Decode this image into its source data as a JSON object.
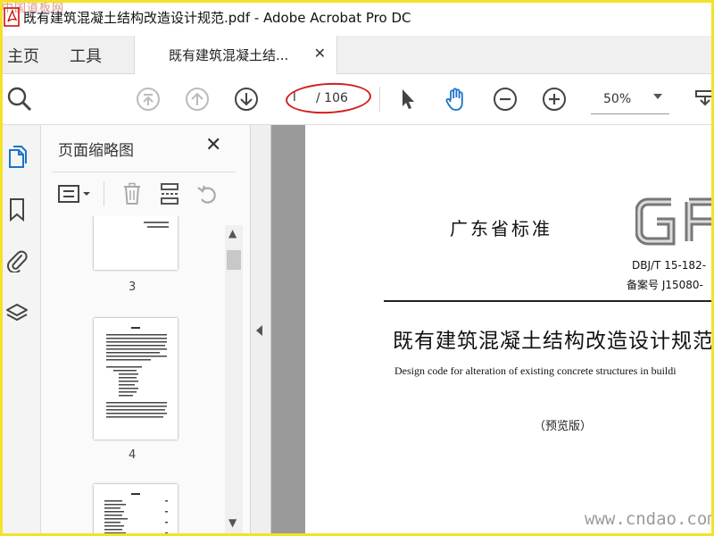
{
  "window": {
    "title": "既有建筑混凝土结构改造设计规范.pdf - Adobe Acrobat Pro DC",
    "watermark_top": "中国道板网"
  },
  "nav": {
    "home": "主页",
    "tools": "工具",
    "doc_tab": "既有建筑混凝土结...",
    "doc_tab_close": "✕"
  },
  "toolbar": {
    "page_current": "I",
    "page_total": "/ 106",
    "zoom": "50%"
  },
  "thumbnails": {
    "title": "页面缩略图",
    "close": "✕",
    "pages": [
      {
        "label": "3"
      },
      {
        "label": "4"
      },
      {
        "label": ""
      }
    ]
  },
  "document": {
    "heading": "广东省标准",
    "logo_text": "GI",
    "standard_code": "DBJ/T 15-182-",
    "record_number": "备案号 J15080-",
    "title": "既有建筑混凝土结构改造设计规范",
    "subtitle": "Design code for alteration of existing concrete structures in buildi",
    "edition": "（预览版）"
  },
  "watermark_bottom": "www.cndao.com",
  "colors": {
    "accent_blue": "#1a73c8",
    "annotation_red": "#d21f1f",
    "frame_yellow": "#f4e12a"
  }
}
